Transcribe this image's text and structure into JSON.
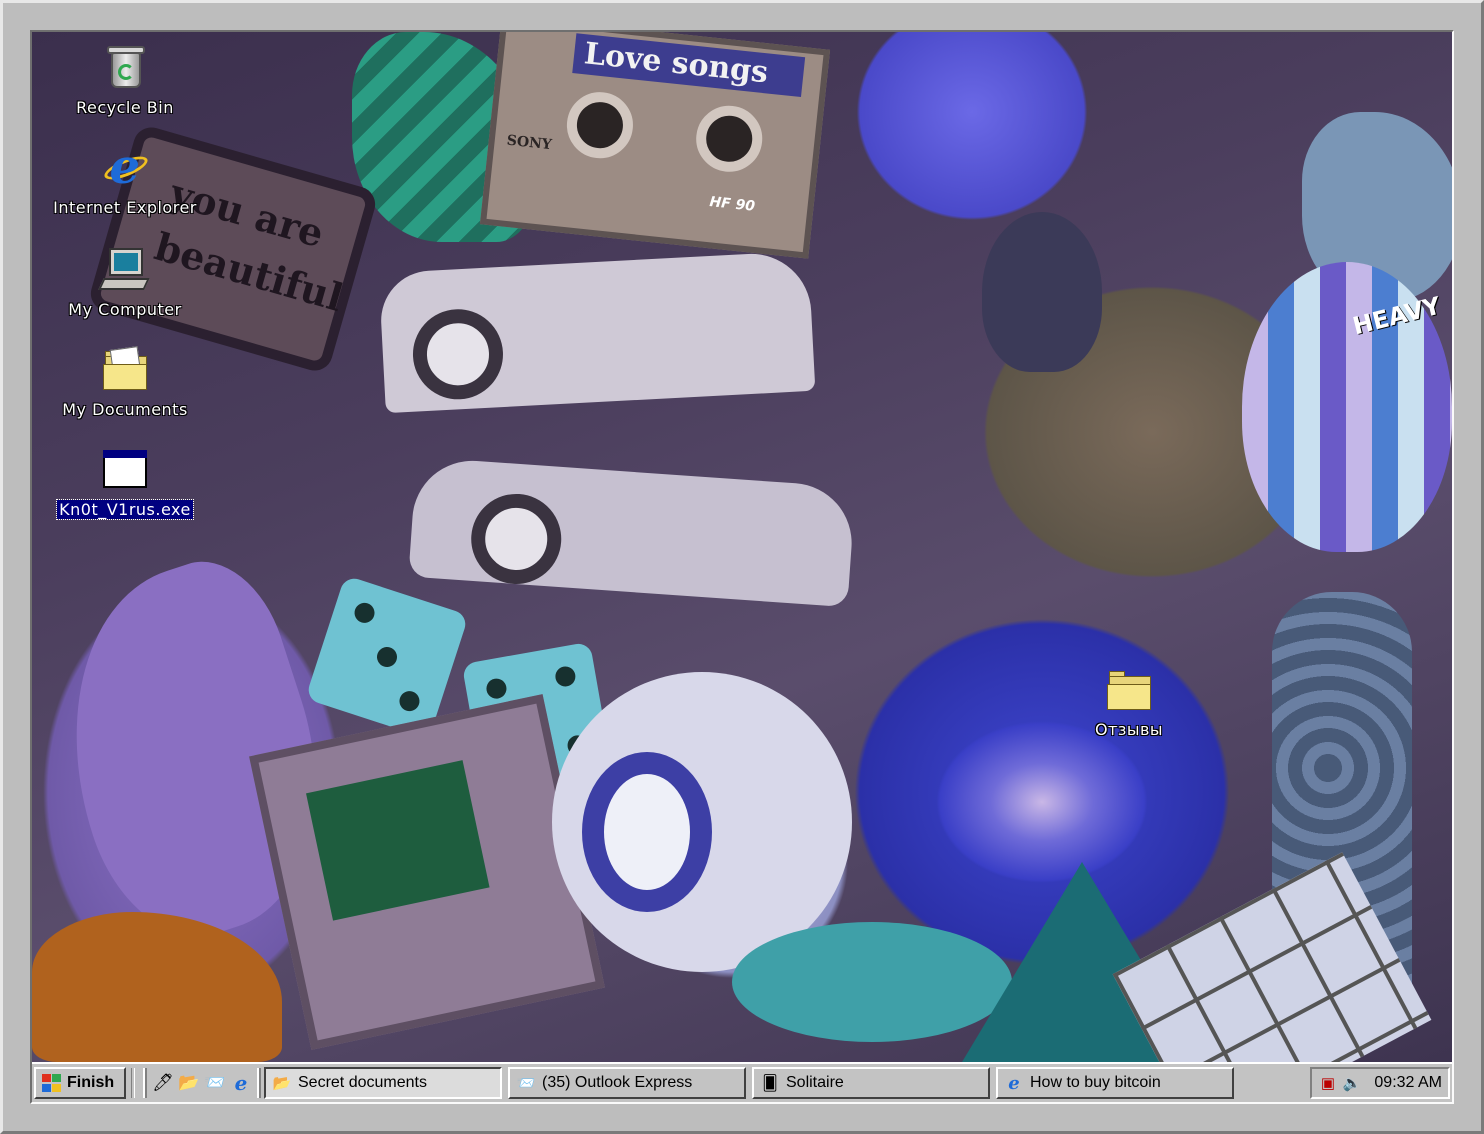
{
  "desktop": {
    "icons": [
      {
        "label": "Recycle Bin",
        "icon": "recycle-bin-icon"
      },
      {
        "label": "Internet Explorer",
        "icon": "internet-explorer-icon"
      },
      {
        "label": "My Computer",
        "icon": "my-computer-icon"
      },
      {
        "label": "My Documents",
        "icon": "folder-documents-icon"
      },
      {
        "label": "Kn0t_V1rus.exe",
        "icon": "executable-window-icon",
        "selected": true
      },
      {
        "label": "Отзывы",
        "icon": "folder-icon"
      }
    ],
    "wallpaper": {
      "cassette_label": "Love songs",
      "sign_line1": "you are",
      "sign_line2": "beautiful",
      "cassette_brand": "SONY",
      "cassette_type": "HF 90",
      "balloon_text": "HEAVY"
    }
  },
  "taskbar": {
    "start_label": "Finish",
    "quick_launch": [
      "show-desktop-icon",
      "folder-open-icon",
      "outlook-icon",
      "internet-explorer-icon"
    ],
    "tasks": [
      {
        "label": "Secret documents",
        "icon": "folder-open-icon",
        "active": true
      },
      {
        "label": "(35) Outlook Express",
        "icon": "outlook-icon",
        "active": false
      },
      {
        "label": "Solitaire",
        "icon": "solitaire-card-icon",
        "active": false
      },
      {
        "label": "How to buy bitcoin",
        "icon": "internet-explorer-icon",
        "active": false
      }
    ],
    "tray": {
      "icons": [
        "network-icon",
        "volume-icon"
      ],
      "clock": "09:32 AM"
    }
  },
  "colors": {
    "taskbar": "#c3c3c3",
    "selection": "#000080",
    "desktop_text": "#ffffff"
  }
}
